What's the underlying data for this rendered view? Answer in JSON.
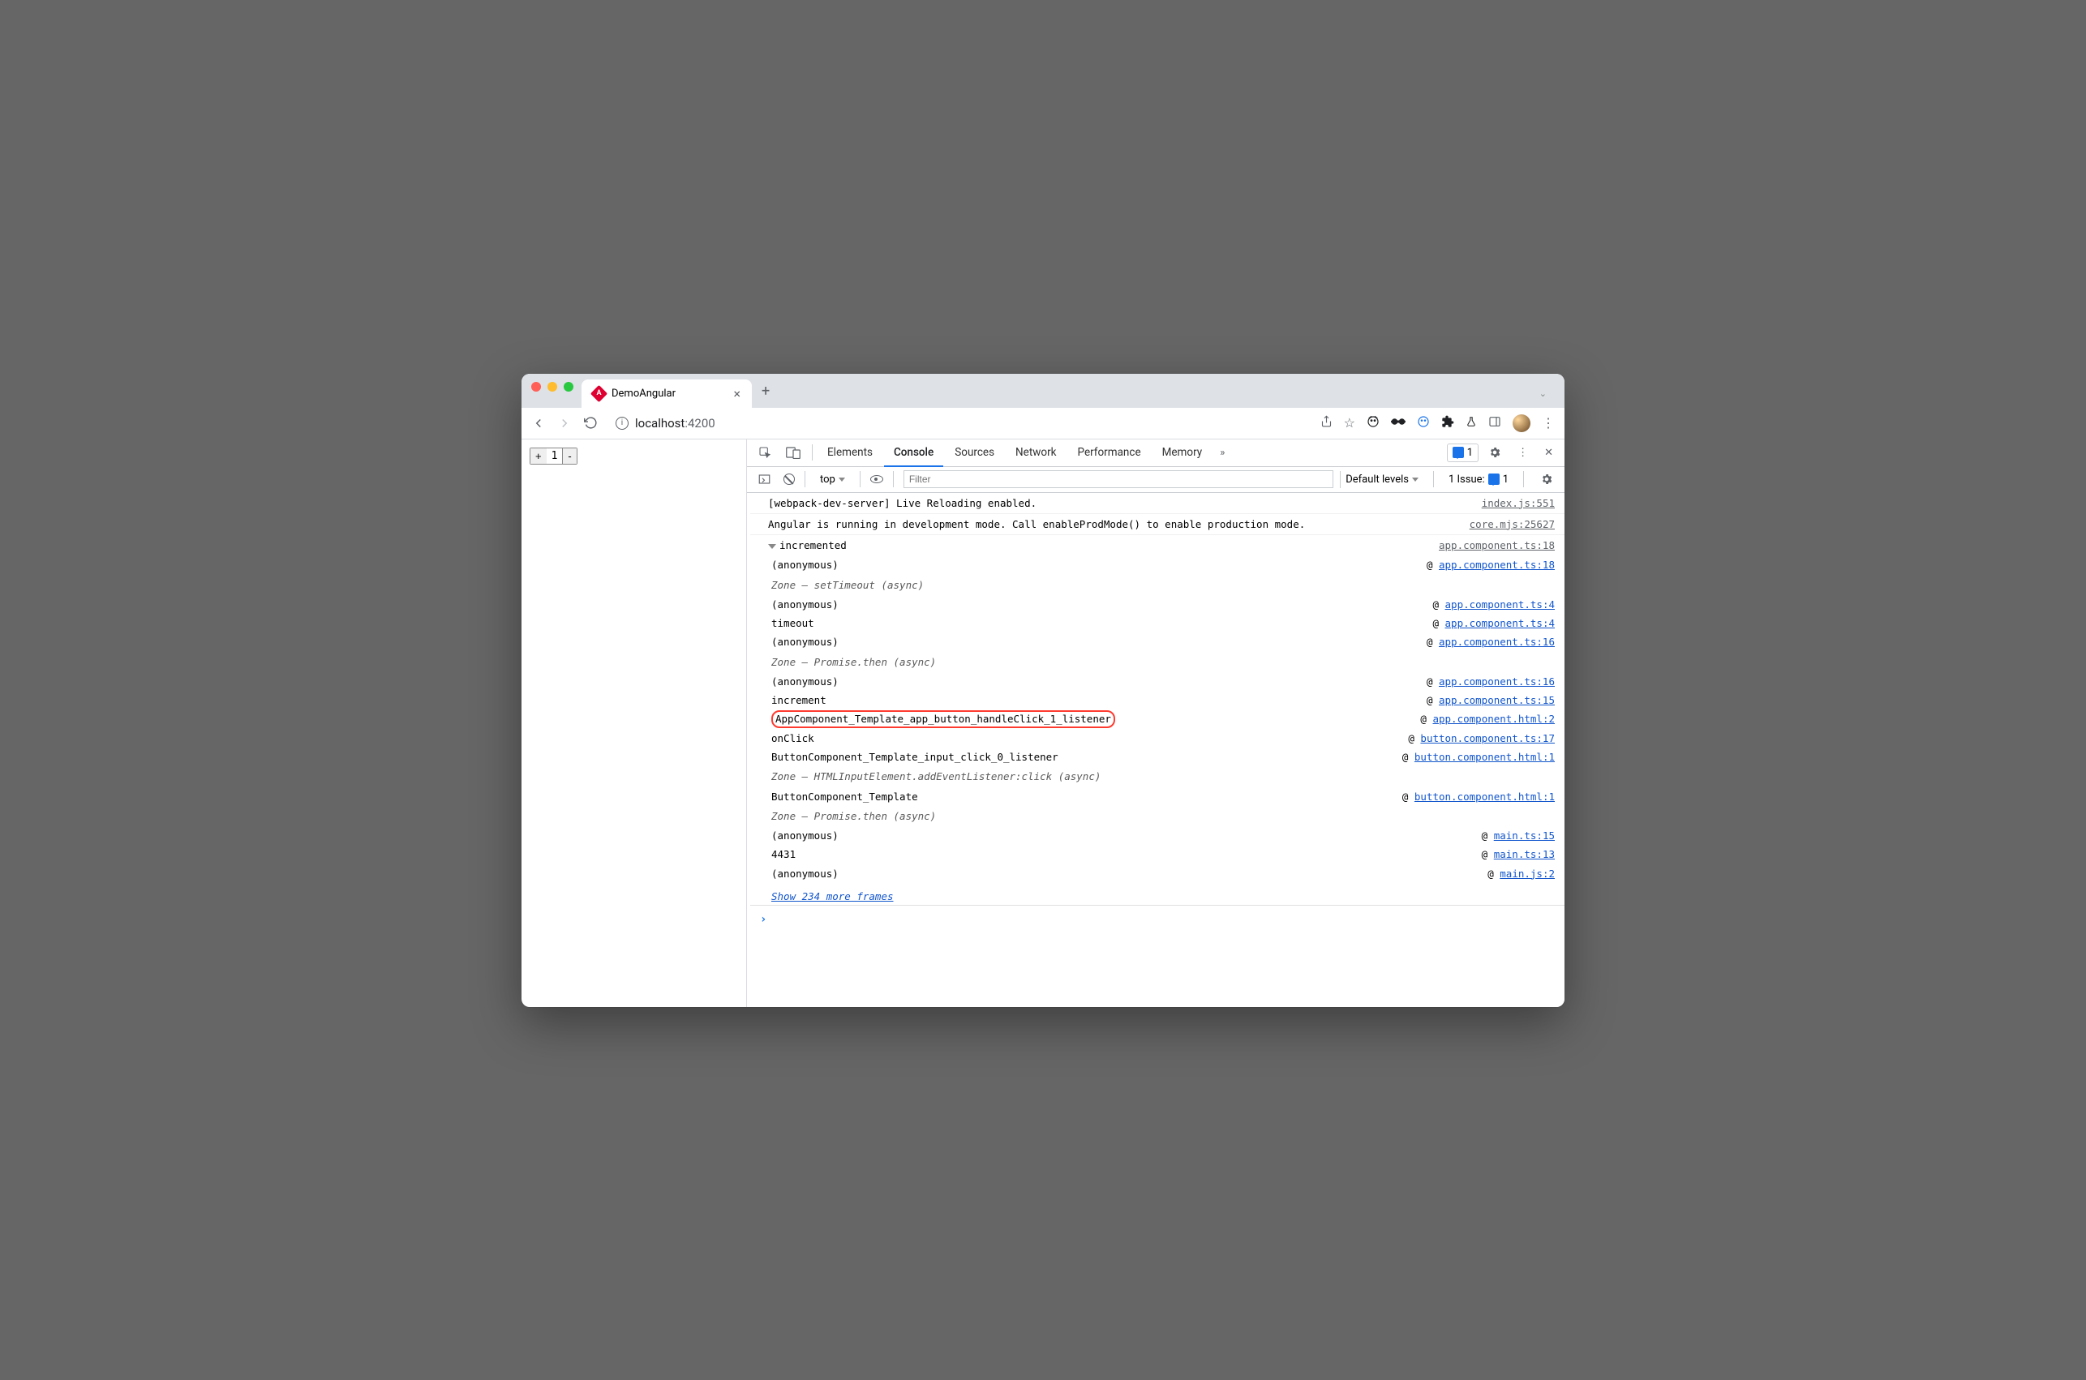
{
  "window": {
    "tab_title": "DemoAngular"
  },
  "url": {
    "host": "localhost",
    "port": ":4200"
  },
  "page": {
    "counter_value": "1"
  },
  "devtools": {
    "tabs": [
      "Elements",
      "Console",
      "Sources",
      "Network",
      "Performance",
      "Memory"
    ],
    "issues_count": "1",
    "issue_text": "1 Issue:",
    "issue_badge": "1",
    "toolbar": {
      "context": "top",
      "filter_placeholder": "Filter",
      "levels": "Default levels"
    }
  },
  "console": {
    "rows": [
      {
        "msg": "[webpack-dev-server] Live Reloading enabled.",
        "src": "index.js:551",
        "srcClass": "src-grey"
      },
      {
        "msg": "Angular is running in development mode. Call enableProdMode() to enable production mode.",
        "src": "core.mjs:25627",
        "srcClass": "src-grey"
      }
    ],
    "trace": {
      "header": "incremented",
      "header_src": "app.component.ts:18",
      "frames": [
        {
          "name": "(anonymous)",
          "src": "app.component.ts:18"
        },
        {
          "zone": "Zone — setTimeout (async)"
        },
        {
          "name": "(anonymous)",
          "src": "app.component.ts:4"
        },
        {
          "name": "timeout",
          "src": "app.component.ts:4"
        },
        {
          "name": "(anonymous)",
          "src": "app.component.ts:16"
        },
        {
          "zone": "Zone — Promise.then (async)"
        },
        {
          "name": "(anonymous)",
          "src": "app.component.ts:16"
        },
        {
          "name": "increment",
          "src": "app.component.ts:15"
        },
        {
          "name": "AppComponent_Template_app_button_handleClick_1_listener",
          "src": "app.component.html:2",
          "highlight": true
        },
        {
          "name": "onClick",
          "src": "button.component.ts:17"
        },
        {
          "name": "ButtonComponent_Template_input_click_0_listener",
          "src": "button.component.html:1"
        },
        {
          "zone": "Zone — HTMLInputElement.addEventListener:click (async)"
        },
        {
          "name": "ButtonComponent_Template",
          "src": "button.component.html:1"
        },
        {
          "zone": "Zone — Promise.then (async)"
        },
        {
          "name": "(anonymous)",
          "src": "main.ts:15"
        },
        {
          "name": "4431",
          "src": "main.ts:13"
        },
        {
          "name": "(anonymous)",
          "src": "main.js:2"
        }
      ],
      "more": "Show 234 more frames"
    }
  }
}
